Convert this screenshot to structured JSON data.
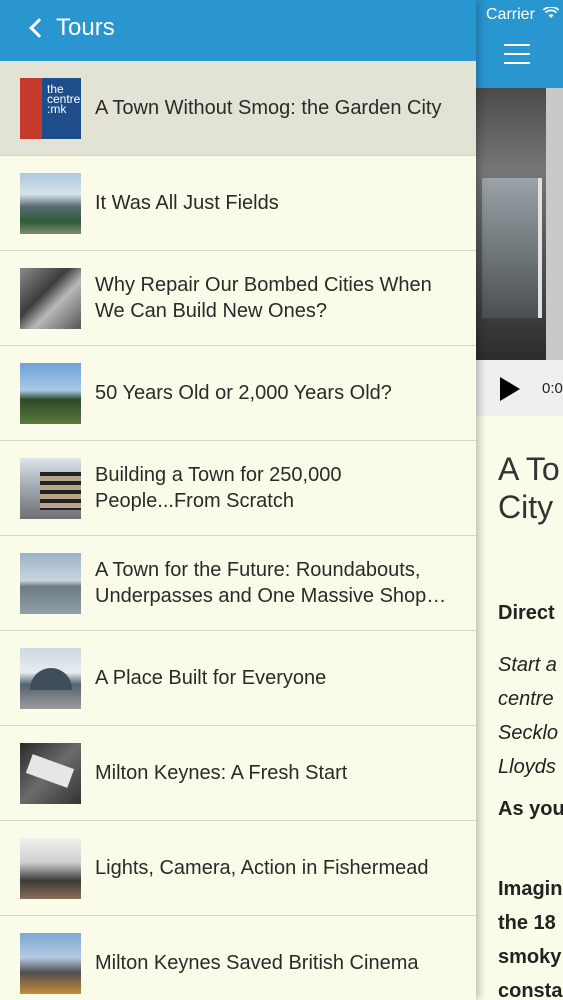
{
  "status": {
    "carrier": "Carrier"
  },
  "nav": {
    "back_label": "Tours"
  },
  "tours": [
    {
      "title": "A Town Without Smog: the Garden City",
      "selected": true,
      "thumb_text": "the centre :mk"
    },
    {
      "title": "It Was All Just Fields"
    },
    {
      "title": "Why Repair Our Bombed Cities When We Can Build New Ones?"
    },
    {
      "title": "50 Years Old or 2,000 Years Old?"
    },
    {
      "title": "Building a Town for 250,000 People...From Scratch"
    },
    {
      "title": "A Town for the Future: Roundabouts, Underpasses and One Massive Shop…"
    },
    {
      "title": "A Place Built for Everyone"
    },
    {
      "title": "Milton Keynes: A Fresh Start"
    },
    {
      "title": "Lights, Camera, Action in Fishermead"
    },
    {
      "title": "Milton Keynes Saved British Cinema"
    }
  ],
  "detail": {
    "time": "0:0",
    "title_line1": "A To",
    "title_line2": "City",
    "directions_label": "Direct",
    "italic_lines": [
      "Start a",
      "centre",
      "Secklo",
      "Lloyds"
    ],
    "as_you": "As you",
    "bold_lines": [
      "Imagin",
      "the 18",
      "smoky",
      "consta"
    ]
  },
  "colors": {
    "nav_blue": "#2a96d0",
    "background": "#fbfbe9",
    "selected_row": "#e2e2d5"
  }
}
